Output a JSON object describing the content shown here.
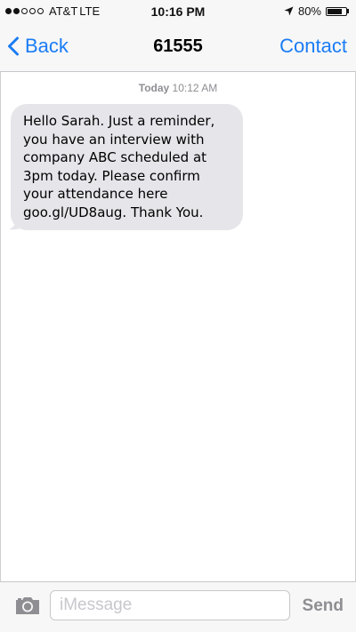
{
  "status_bar": {
    "signal_total": 5,
    "signal_filled": 2,
    "carrier": "AT&T",
    "network": "LTE",
    "time": "10:16 PM",
    "location_icon": "location-arrow-icon",
    "battery_text": "80%",
    "battery_level": 0.8
  },
  "nav": {
    "back_label": "Back",
    "title": "61555",
    "contact_label": "Contact",
    "accent": "#1a7cf5"
  },
  "conversation": {
    "timestamp_day": "Today",
    "timestamp_time": "10:12 AM",
    "messages": [
      {
        "direction": "incoming",
        "lines": [
          "Hello Sarah. Just a reminder,",
          "you have an interview with",
          "company ABC scheduled at",
          "3pm today. Please confirm",
          "your attendance here",
          "goo.gl/UD8aug. Thank You."
        ],
        "bubble_color": "#e5e5ea"
      }
    ]
  },
  "composer": {
    "camera_icon": "camera-icon",
    "placeholder": "iMessage",
    "value": "",
    "send_label": "Send"
  }
}
